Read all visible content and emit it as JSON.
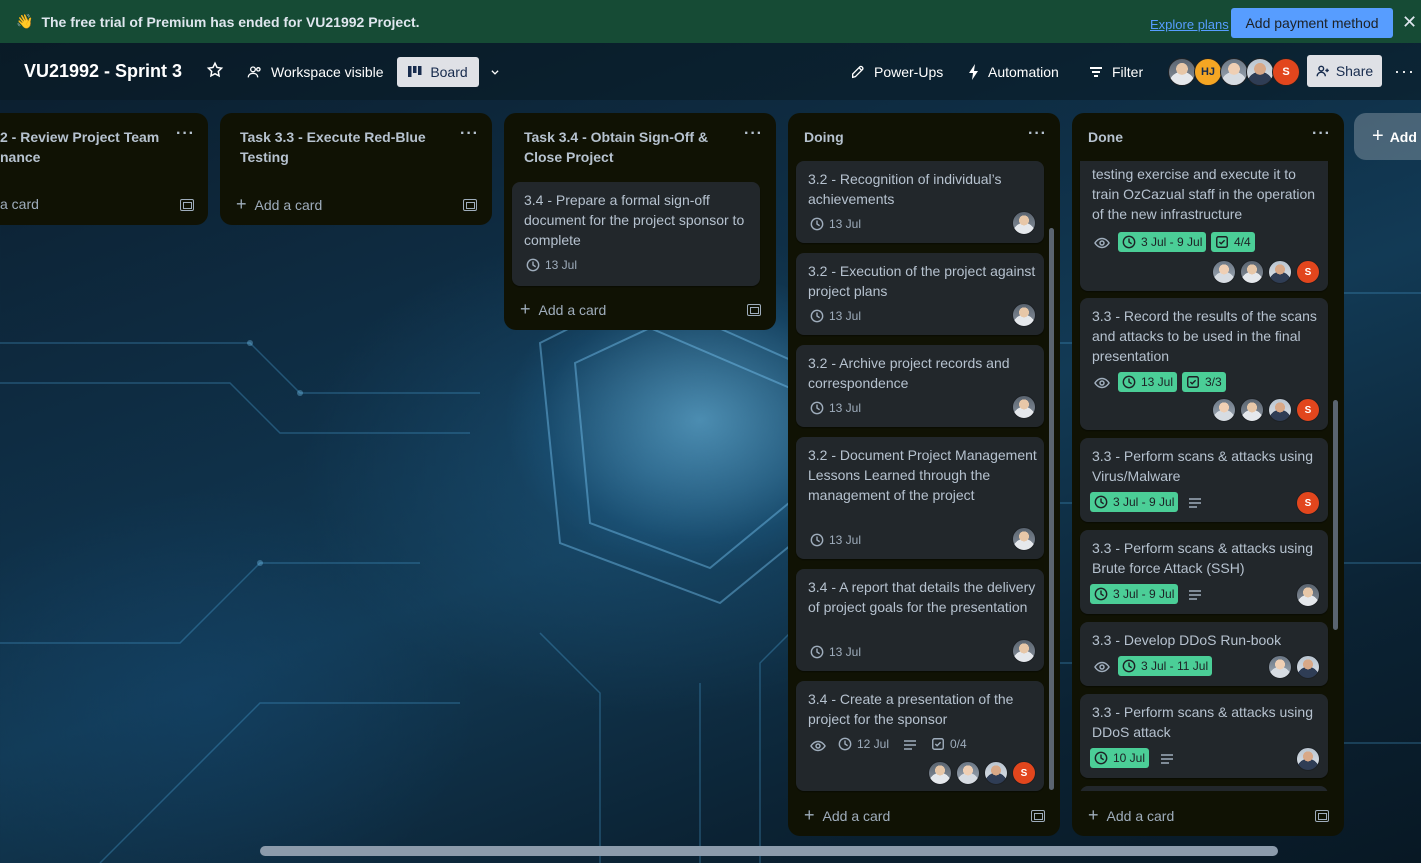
{
  "banner": {
    "icon": "waving-hand-icon",
    "message": "The free trial of Premium has ended for VU21992 Project.",
    "explore_link": "Explore plans",
    "payment_button": "Add payment method",
    "close_icon": "close-icon",
    "background": "#164b35"
  },
  "header": {
    "board_title": "VU21992 - Sprint 3",
    "visibility": "Workspace visible",
    "view_button": "Board",
    "power_ups": "Power-Ups",
    "automation": "Automation",
    "filter": "Filter",
    "members": [
      "photo",
      "HJ",
      "photo",
      "photo",
      "S"
    ],
    "share": "Share"
  },
  "lists": [
    {
      "title_lines": [
        "2 - Review Project Team",
        "nance"
      ],
      "add_card": "a card",
      "cards": []
    },
    {
      "title_lines": [
        "Task 3.3 - Execute Red-Blue",
        "Testing"
      ],
      "add_card": "Add a card",
      "cards": []
    },
    {
      "title_lines": [
        "Task 3.4 - Obtain Sign-Off &",
        "Close Project"
      ],
      "add_card": "Add a card",
      "cards": [
        {
          "title": "3.4 - Prepare a formal sign-off document for the project sponsor to complete",
          "date": "13 Jul"
        }
      ]
    },
    {
      "title": "Doing",
      "add_card": "Add a card",
      "cards": [
        {
          "title": "3.2 - Recognition of individual’s achievements",
          "date": "13 Jul"
        },
        {
          "title": "3.2 - Execution of the project against project plans",
          "date": "13 Jul"
        },
        {
          "title": "3.2 - Archive project records and correspondence",
          "date": "13 Jul"
        },
        {
          "title": "3.2 - Document Project Management Lessons Learned through the management of the project",
          "date": "13 Jul"
        },
        {
          "title": "3.4 - A report that details the delivery of project goals for the presentation",
          "date": "13 Jul"
        },
        {
          "title": "3.4 - Create a presentation of the project for the sponsor",
          "date": "12 Jul",
          "checklist": "0/4"
        }
      ]
    },
    {
      "title": "Done",
      "add_card": "Add a card",
      "cards": [
        {
          "title": "testing exercise and execute it to train OzCazual staff in the operation of the new infrastructure",
          "date": "3 Jul - 9 Jul",
          "checklist": "4/4"
        },
        {
          "title": "3.3 - Record the results of the scans and attacks to be used in the final presentation",
          "date": "13 Jul",
          "checklist": "3/3"
        },
        {
          "title": "3.3 - Perform scans & attacks using Virus/Malware",
          "date": "3 Jul - 9 Jul"
        },
        {
          "title": "3.3 - Perform scans & attacks using Brute force Attack (SSH)",
          "date": "3 Jul - 9 Jul"
        },
        {
          "title": "3.3 - Develop DDoS Run-book",
          "date": "3 Jul - 11 Jul"
        },
        {
          "title": "3.3 - Perform scans & attacks using DDoS attack",
          "date": "10 Jul"
        }
      ]
    }
  ],
  "add_list": "Add",
  "avatar_initial": "S",
  "colors": {
    "list_bg": "#101204",
    "card_bg": "#22272b",
    "due_complete": "#4bce97",
    "accent": "#579dff",
    "avatar_s": "#e2461d"
  }
}
